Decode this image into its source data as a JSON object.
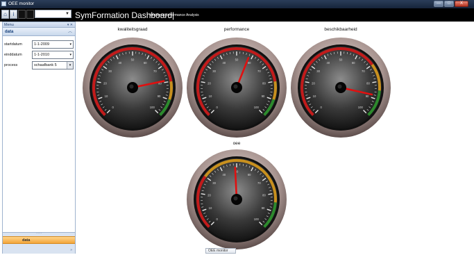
{
  "window": {
    "title": "OEE monitor",
    "buttons": [
      "—",
      "□",
      "X"
    ]
  },
  "toolbar": {
    "title": "SymFormation Dashboard|",
    "subtitle": "Intelligent performance Analysis",
    "combo_value": ""
  },
  "sidebar": {
    "header": "Menu",
    "pins": "▾ ✕",
    "section": "data",
    "fields": [
      {
        "label": "startdatum",
        "value": "1-1-2009"
      },
      {
        "label": "einddatum",
        "value": "1-1-2010"
      },
      {
        "label": "process",
        "value": "schaafbank 5"
      }
    ],
    "bottom_tab": "data"
  },
  "gauges": [
    {
      "label": "kwaliteitsgraad",
      "value": 79
    },
    {
      "label": "performance",
      "value": 58
    },
    {
      "label": "beschikbaarheid",
      "value": 88
    },
    {
      "label": "oee",
      "value": 49
    }
  ],
  "gauge_scale": {
    "min": 0,
    "max": 100,
    "major_labels": [
      "0",
      "10",
      "20",
      "30",
      "40",
      "50",
      "60",
      "70",
      "80",
      "90",
      "100"
    ]
  },
  "colors": {
    "red": "#c21b1b",
    "amber": "#c8901e",
    "green": "#2d8a2d"
  },
  "taskbar": {
    "button": "OEE monitor"
  }
}
